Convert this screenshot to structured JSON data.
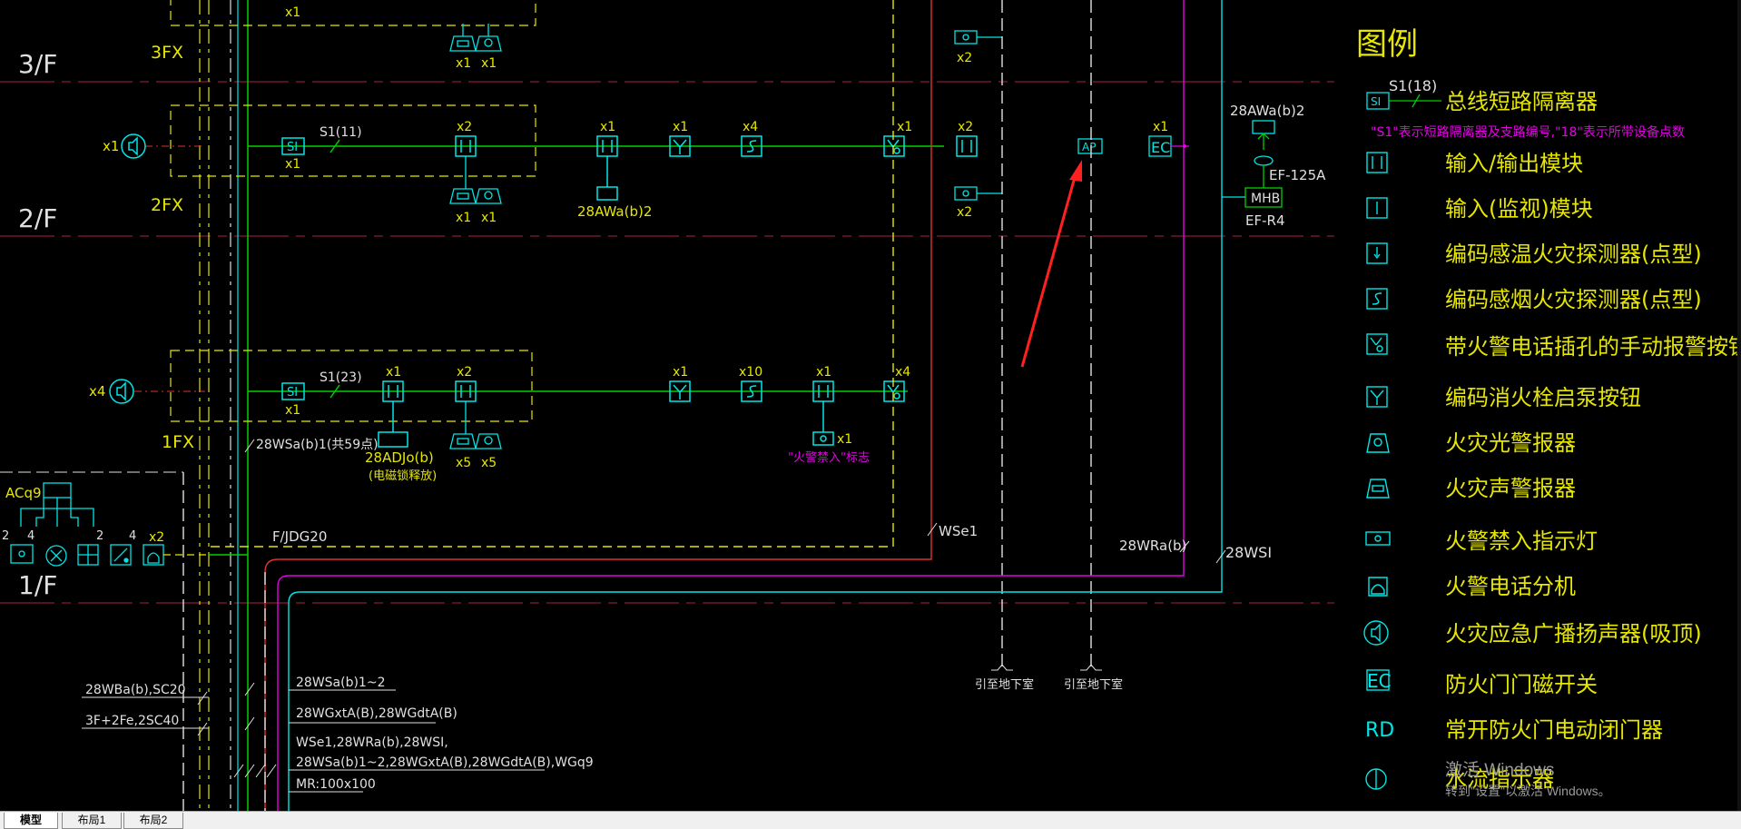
{
  "floors": {
    "f3": "3/F",
    "f2": "2/F",
    "f1": "1/F"
  },
  "panels": {
    "p3": "3FX",
    "p2": "2FX",
    "p1": "1FX"
  },
  "counts": {
    "x1": "x1",
    "x2": "x2",
    "x4": "x4",
    "x5": "x5",
    "x10": "x10"
  },
  "labels": {
    "s1_11": "S1(11)",
    "s1_23": "S1(23)",
    "awa_2f": "28AWa(b)2",
    "awa_right": "28AWa(b)2",
    "adjo": "28ADJo(b)",
    "adjo_note": "(电磁锁释放)",
    "wsa_1f": "28WSa(b)1(共59点)",
    "forbid_sign": "\"火警禁入\"标志",
    "f_jdg20": "F/JDG20",
    "wse1": "WSe1",
    "wra": "28WRa(b)",
    "wsi": "28WSI",
    "ef125a": "EF-125A",
    "mhb": "MHB",
    "efr4": "EF-R4",
    "acq9": "ACq9",
    "to_basement_1": "引至地下室",
    "to_basement_2": "引至地下室",
    "ap": "AP",
    "ec": "EC",
    "si": "SI",
    "wba": "28WBa(b),SC20",
    "fe": "3F+2Fe,2SC40",
    "wsa12": "28WSa(b)1~2",
    "wgxta": "28WGxtA(B),28WGdtA(B)",
    "multi1": "WSe1,28WRa(b),28WSI,",
    "multi2": "28WSa(b)1~2,28WGxtA(B),28WGdtA(B),WGq9",
    "mr": "MR:100x100",
    "n2": "2",
    "n4": "4"
  },
  "legend": {
    "title": "图例",
    "items": [
      {
        "code": "S1(18)",
        "text": "总线短路隔离器"
      },
      {
        "text": "\"S1\"表示短路隔离器及支路编号,\"18\"表示所带设备点数"
      },
      {
        "text": "输入/输出模块"
      },
      {
        "text": "输入(监视)模块"
      },
      {
        "text": "编码感温火灾探测器(点型)"
      },
      {
        "text": "编码感烟火灾探测器(点型)"
      },
      {
        "text": "带火警电话插孔的手动报警按钮"
      },
      {
        "text": "编码消火栓启泵按钮"
      },
      {
        "text": "火灾光警报器"
      },
      {
        "text": "火灾声警报器"
      },
      {
        "text": "火警禁入指示灯"
      },
      {
        "text": "火警电话分机"
      },
      {
        "text": "火灾应急广播扬声器(吸顶)"
      },
      {
        "text": "防火门门磁开关"
      },
      {
        "text": "常开防火门电动闭门器"
      },
      {
        "text": "水流指示器"
      }
    ],
    "symbols": {
      "ec": "EC",
      "rd": "RD"
    }
  },
  "tabs": [
    {
      "label": "模型",
      "active": true
    },
    {
      "label": "布局1",
      "active": false
    },
    {
      "label": "布局2",
      "active": false
    }
  ],
  "watermark": {
    "title": "激活 Windows",
    "subtitle": "转到\"设置\"以激活 Windows。"
  },
  "colors": {
    "background": "#000000",
    "yellow": "#e6e600",
    "green": "#00d000",
    "cyan": "#00e5e5",
    "magenta": "#e600e6",
    "red": "#e03030",
    "arrow": "#ff2020"
  }
}
